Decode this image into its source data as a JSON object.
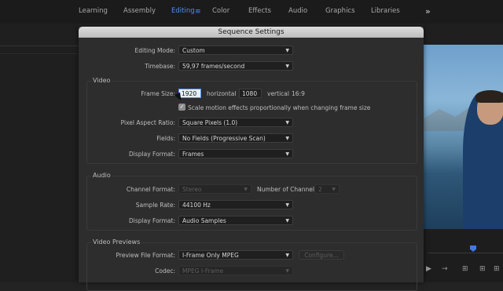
{
  "workspace": {
    "tabs": [
      "Learning",
      "Assembly",
      "Editing",
      "Color",
      "Effects",
      "Audio",
      "Graphics",
      "Libraries"
    ],
    "active": "Editing",
    "menu_glyph": "≡",
    "overflow_glyph": "»"
  },
  "dialog": {
    "title": "Sequence Settings",
    "editing_mode": {
      "label": "Editing Mode:",
      "value": "Custom"
    },
    "timebase": {
      "label": "Timebase:",
      "value": "59,97  frames/second"
    },
    "video": {
      "title": "Video",
      "frame_size_label": "Frame Size:",
      "width": "1920",
      "horizontal": "horizontal",
      "height": "1080",
      "vertical": "vertical",
      "aspect": "16:9",
      "scale_checkbox": "Scale motion effects proportionally when changing frame size",
      "scale_checked": true,
      "pixel_aspect": {
        "label": "Pixel Aspect Ratio:",
        "value": "Square Pixels (1.0)"
      },
      "fields": {
        "label": "Fields:",
        "value": "No Fields (Progressive Scan)"
      },
      "display_format": {
        "label": "Display Format:",
        "value": "Frames"
      }
    },
    "audio": {
      "title": "Audio",
      "channel_format": {
        "label": "Channel Format:",
        "value": "Stereo"
      },
      "num_channels": {
        "label": "Number of Channels:",
        "value": "2"
      },
      "sample_rate": {
        "label": "Sample Rate:",
        "value": "44100 Hz"
      },
      "display_format": {
        "label": "Display Format:",
        "value": "Audio Samples"
      }
    },
    "previews": {
      "title": "Video Previews",
      "file_format": {
        "label": "Preview File Format:",
        "value": "I-Frame Only MPEG"
      },
      "configure": "Configure...",
      "codec": {
        "label": "Codec:",
        "value": "MPEG I-Frame"
      }
    }
  }
}
